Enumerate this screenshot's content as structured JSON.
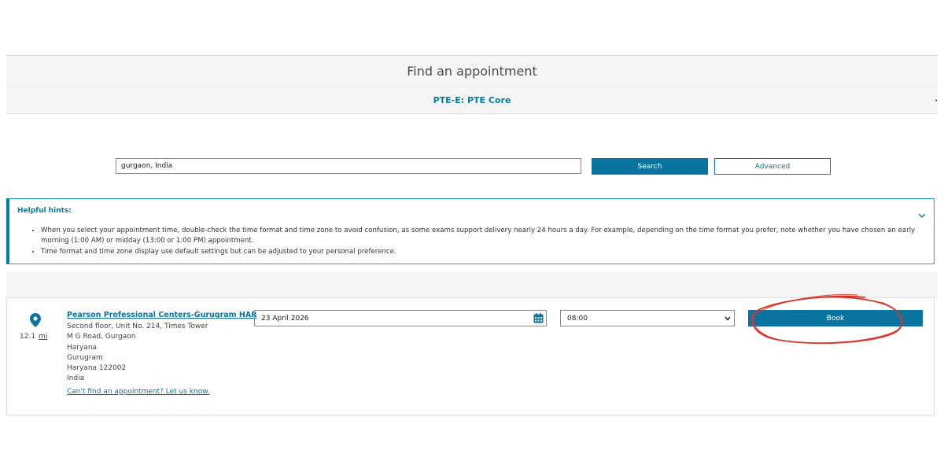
{
  "header": {
    "title": "Find an appointment",
    "exam": "PTE-E: PTE Core"
  },
  "search": {
    "value": "gurgaon, India",
    "search_label": "Search",
    "advanced_label": "Advanced"
  },
  "hints": {
    "title": "Helpful hints:",
    "items": [
      "When you select your appointment time, double-check the time format and time zone to avoid confusion, as some exams support delivery nearly 24 hours a day. For example, depending on the time format you prefer, note whether you have chosen an early morning (1:00 AM) or midday (13:00 or 1:00 PM) appointment.",
      "Time format and time zone display use default settings but can be adjusted to your personal preference."
    ]
  },
  "result": {
    "distance_value": "12.1",
    "distance_unit": "mi",
    "center_name": "Pearson Professional Centers-Gurugram HAR",
    "address_lines": [
      "Second floor, Unit No. 214, Times Tower",
      "M G Road, Gurgaon",
      "Haryana",
      "Gurugram",
      "Haryana 122002",
      "India"
    ],
    "help_link": "Can't find an appointment? Let us know.",
    "date": "23 April 2026",
    "time": "08:00",
    "book_label": "Book"
  },
  "colors": {
    "primary": "#0b73a0",
    "accent_text": "#007fa3",
    "annotation": "#d9342b"
  }
}
